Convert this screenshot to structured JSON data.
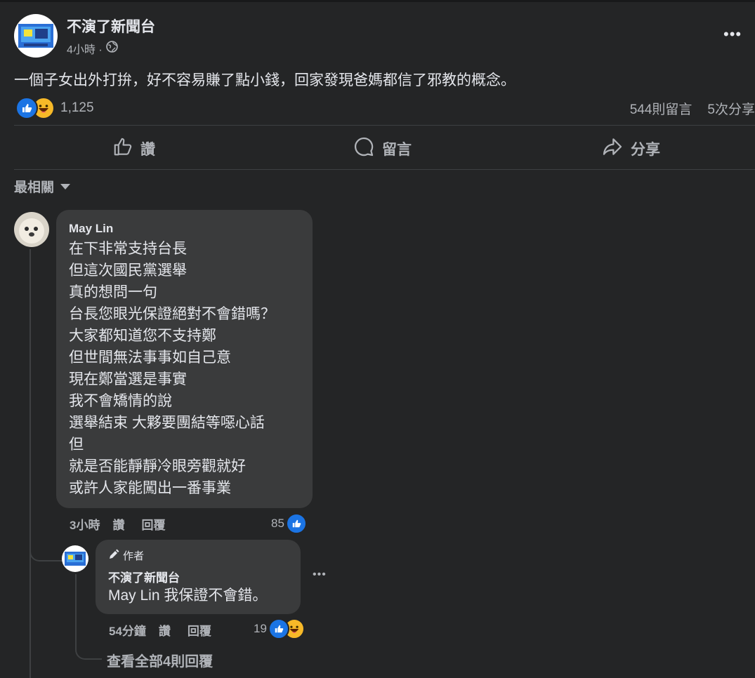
{
  "post": {
    "page_name": "不演了新聞台",
    "time": "4小時 ·",
    "text": "一個子女出外打拚，好不容易賺了點小錢，回家發現爸媽都信了邪教的概念。",
    "reaction_count": "1,125",
    "comments_count": "544則留言",
    "shares_count": "5次分享"
  },
  "actions": {
    "like": "讚",
    "comment": "留言",
    "share": "分享"
  },
  "sort_label": "最相關",
  "comment": {
    "author": "May Lin",
    "lines": [
      "在下非常支持台長",
      "但這次國民黨選舉",
      "真的想問一句",
      "台長您眼光保證絕對不會錯嗎？",
      "大家都知道您不支持鄭",
      "但世間無法事事如自己意",
      "現在鄭當選是事實",
      "我不會矯情的說",
      "選舉結束 大夥要團結等噁心話",
      "但",
      "就是否能靜靜冷眼旁觀就好",
      "或許人家能闖出一番事業"
    ],
    "time": "3小時",
    "like": "讚",
    "reply": "回覆",
    "reactions": "85"
  },
  "reply": {
    "badge": "作者",
    "author": "不演了新聞台",
    "mention": "May Lin",
    "text": " 我保證不會錯。",
    "time": "54分鐘",
    "like": "讚",
    "reply": "回覆",
    "reactions": "19"
  },
  "view_replies": "查看全部4則回覆",
  "colors": {
    "background": "#242526",
    "bubble": "#3a3b3c",
    "like_blue": "#1b74e4",
    "haha_yellow": "#f7b928",
    "text": "#e4e6eb",
    "secondary": "#b0b3b8"
  }
}
